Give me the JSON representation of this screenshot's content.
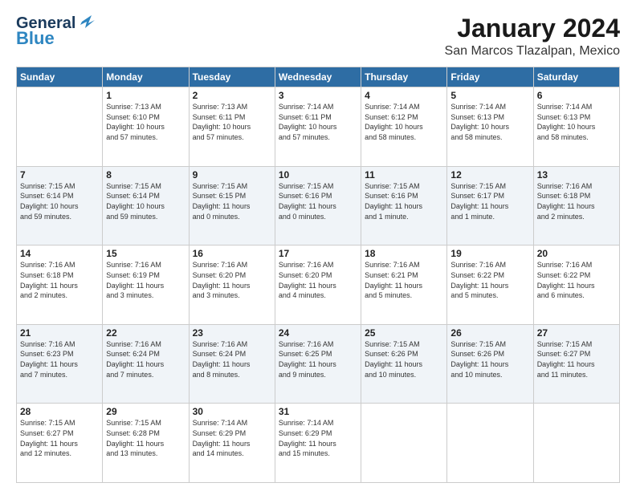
{
  "logo": {
    "line1": "General",
    "line2": "Blue"
  },
  "header": {
    "month": "January 2024",
    "location": "San Marcos Tlazalpan, Mexico"
  },
  "weekdays": [
    "Sunday",
    "Monday",
    "Tuesday",
    "Wednesday",
    "Thursday",
    "Friday",
    "Saturday"
  ],
  "weeks": [
    [
      {
        "day": "",
        "info": ""
      },
      {
        "day": "1",
        "info": "Sunrise: 7:13 AM\nSunset: 6:10 PM\nDaylight: 10 hours\nand 57 minutes."
      },
      {
        "day": "2",
        "info": "Sunrise: 7:13 AM\nSunset: 6:11 PM\nDaylight: 10 hours\nand 57 minutes."
      },
      {
        "day": "3",
        "info": "Sunrise: 7:14 AM\nSunset: 6:11 PM\nDaylight: 10 hours\nand 57 minutes."
      },
      {
        "day": "4",
        "info": "Sunrise: 7:14 AM\nSunset: 6:12 PM\nDaylight: 10 hours\nand 58 minutes."
      },
      {
        "day": "5",
        "info": "Sunrise: 7:14 AM\nSunset: 6:13 PM\nDaylight: 10 hours\nand 58 minutes."
      },
      {
        "day": "6",
        "info": "Sunrise: 7:14 AM\nSunset: 6:13 PM\nDaylight: 10 hours\nand 58 minutes."
      }
    ],
    [
      {
        "day": "7",
        "info": "Sunrise: 7:15 AM\nSunset: 6:14 PM\nDaylight: 10 hours\nand 59 minutes."
      },
      {
        "day": "8",
        "info": "Sunrise: 7:15 AM\nSunset: 6:14 PM\nDaylight: 10 hours\nand 59 minutes."
      },
      {
        "day": "9",
        "info": "Sunrise: 7:15 AM\nSunset: 6:15 PM\nDaylight: 11 hours\nand 0 minutes."
      },
      {
        "day": "10",
        "info": "Sunrise: 7:15 AM\nSunset: 6:16 PM\nDaylight: 11 hours\nand 0 minutes."
      },
      {
        "day": "11",
        "info": "Sunrise: 7:15 AM\nSunset: 6:16 PM\nDaylight: 11 hours\nand 1 minute."
      },
      {
        "day": "12",
        "info": "Sunrise: 7:15 AM\nSunset: 6:17 PM\nDaylight: 11 hours\nand 1 minute."
      },
      {
        "day": "13",
        "info": "Sunrise: 7:16 AM\nSunset: 6:18 PM\nDaylight: 11 hours\nand 2 minutes."
      }
    ],
    [
      {
        "day": "14",
        "info": "Sunrise: 7:16 AM\nSunset: 6:18 PM\nDaylight: 11 hours\nand 2 minutes."
      },
      {
        "day": "15",
        "info": "Sunrise: 7:16 AM\nSunset: 6:19 PM\nDaylight: 11 hours\nand 3 minutes."
      },
      {
        "day": "16",
        "info": "Sunrise: 7:16 AM\nSunset: 6:20 PM\nDaylight: 11 hours\nand 3 minutes."
      },
      {
        "day": "17",
        "info": "Sunrise: 7:16 AM\nSunset: 6:20 PM\nDaylight: 11 hours\nand 4 minutes."
      },
      {
        "day": "18",
        "info": "Sunrise: 7:16 AM\nSunset: 6:21 PM\nDaylight: 11 hours\nand 5 minutes."
      },
      {
        "day": "19",
        "info": "Sunrise: 7:16 AM\nSunset: 6:22 PM\nDaylight: 11 hours\nand 5 minutes."
      },
      {
        "day": "20",
        "info": "Sunrise: 7:16 AM\nSunset: 6:22 PM\nDaylight: 11 hours\nand 6 minutes."
      }
    ],
    [
      {
        "day": "21",
        "info": "Sunrise: 7:16 AM\nSunset: 6:23 PM\nDaylight: 11 hours\nand 7 minutes."
      },
      {
        "day": "22",
        "info": "Sunrise: 7:16 AM\nSunset: 6:24 PM\nDaylight: 11 hours\nand 7 minutes."
      },
      {
        "day": "23",
        "info": "Sunrise: 7:16 AM\nSunset: 6:24 PM\nDaylight: 11 hours\nand 8 minutes."
      },
      {
        "day": "24",
        "info": "Sunrise: 7:16 AM\nSunset: 6:25 PM\nDaylight: 11 hours\nand 9 minutes."
      },
      {
        "day": "25",
        "info": "Sunrise: 7:15 AM\nSunset: 6:26 PM\nDaylight: 11 hours\nand 10 minutes."
      },
      {
        "day": "26",
        "info": "Sunrise: 7:15 AM\nSunset: 6:26 PM\nDaylight: 11 hours\nand 10 minutes."
      },
      {
        "day": "27",
        "info": "Sunrise: 7:15 AM\nSunset: 6:27 PM\nDaylight: 11 hours\nand 11 minutes."
      }
    ],
    [
      {
        "day": "28",
        "info": "Sunrise: 7:15 AM\nSunset: 6:27 PM\nDaylight: 11 hours\nand 12 minutes."
      },
      {
        "day": "29",
        "info": "Sunrise: 7:15 AM\nSunset: 6:28 PM\nDaylight: 11 hours\nand 13 minutes."
      },
      {
        "day": "30",
        "info": "Sunrise: 7:14 AM\nSunset: 6:29 PM\nDaylight: 11 hours\nand 14 minutes."
      },
      {
        "day": "31",
        "info": "Sunrise: 7:14 AM\nSunset: 6:29 PM\nDaylight: 11 hours\nand 15 minutes."
      },
      {
        "day": "",
        "info": ""
      },
      {
        "day": "",
        "info": ""
      },
      {
        "day": "",
        "info": ""
      }
    ]
  ]
}
